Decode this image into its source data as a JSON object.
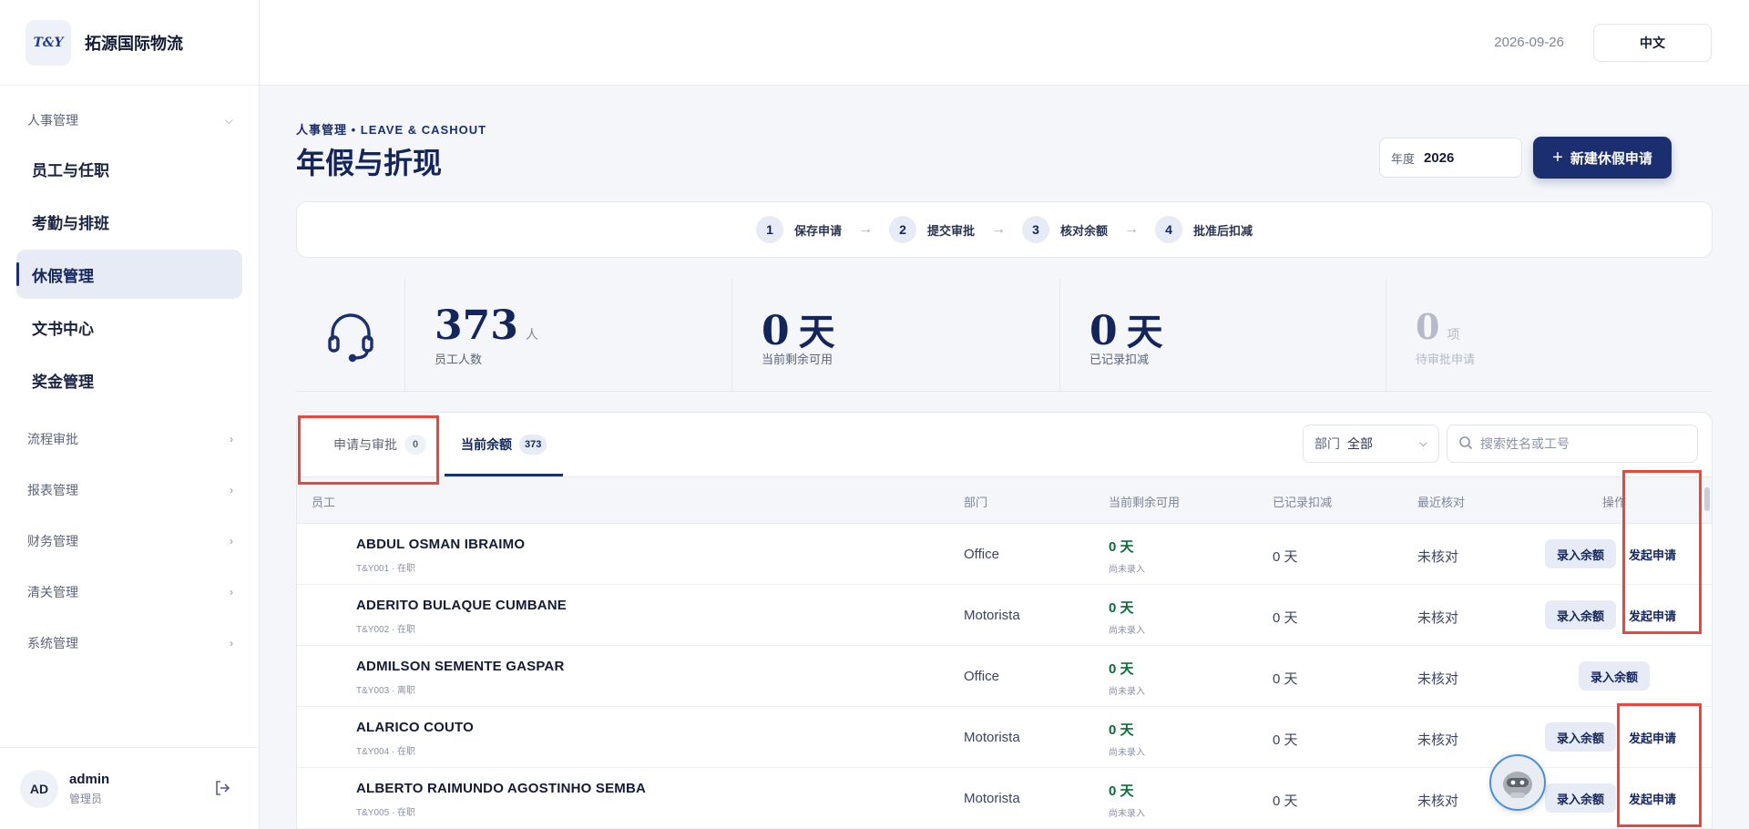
{
  "brand": {
    "logo_text": "T&Y",
    "name": "拓源国际物流"
  },
  "sidebar": {
    "group1": {
      "label": "人事管理"
    },
    "items": [
      {
        "label": "员工与任职",
        "active": false
      },
      {
        "label": "考勤与排班",
        "active": false
      },
      {
        "label": "休假管理",
        "active": true
      },
      {
        "label": "文书中心",
        "active": false
      },
      {
        "label": "奖金管理",
        "active": false
      }
    ],
    "groups": [
      {
        "label": "流程审批"
      },
      {
        "label": "报表管理"
      },
      {
        "label": "财务管理"
      },
      {
        "label": "清关管理"
      },
      {
        "label": "系统管理"
      }
    ]
  },
  "user": {
    "initials": "AD",
    "name": "admin",
    "role": "管理员"
  },
  "topbar": {
    "date": "2026-09-26",
    "language": "中文"
  },
  "page": {
    "kicker": "人事管理 • LEAVE & CASHOUT",
    "title": "年假与折现",
    "year_label": "年度",
    "year_value": "2026",
    "new_button": "新建休假申请"
  },
  "steps": [
    {
      "num": "1",
      "label": "保存申请"
    },
    {
      "num": "2",
      "label": "提交审批"
    },
    {
      "num": "3",
      "label": "核对余额"
    },
    {
      "num": "4",
      "label": "批准后扣减"
    }
  ],
  "stats": [
    {
      "value": "373",
      "unit": "人",
      "label": "员工人数"
    },
    {
      "value": "0",
      "unit": "天",
      "label": "当前剩余可用"
    },
    {
      "value": "0",
      "unit": "天",
      "label": "已记录扣减"
    },
    {
      "value": "0",
      "unit": "项",
      "label": "待审批申请"
    }
  ],
  "tabs": [
    {
      "label": "申请与审批",
      "count": "0"
    },
    {
      "label": "当前余额",
      "count": "373"
    }
  ],
  "filters": {
    "dept_label": "部门",
    "dept_value": "全部",
    "search_placeholder": "搜索姓名或工号"
  },
  "table": {
    "headers": {
      "employee": "员工",
      "dept": "部门",
      "available": "当前剩余可用",
      "used": "已记录扣减",
      "checked": "最近核对",
      "actions": "操作"
    },
    "entry_label": "录入余额",
    "apply_label": "发起申请",
    "rows": [
      {
        "name": "ABDUL OSMAN IBRAIMO",
        "sub": "T&Y001 · 在职",
        "dept": "Office",
        "available": "0 天",
        "available_sub": "尚未录入",
        "used": "0 天",
        "checked": "未核对",
        "can_apply": true
      },
      {
        "name": "ADERITO BULAQUE CUMBANE",
        "sub": "T&Y002 · 在职",
        "dept": "Motorista",
        "available": "0 天",
        "available_sub": "尚未录入",
        "used": "0 天",
        "checked": "未核对",
        "can_apply": true
      },
      {
        "name": "ADMILSON SEMENTE GASPAR",
        "sub": "T&Y003 · 离职",
        "dept": "Office",
        "available": "0 天",
        "available_sub": "尚未录入",
        "used": "0 天",
        "checked": "未核对",
        "can_apply": false
      },
      {
        "name": "ALARICO COUTO",
        "sub": "T&Y004 · 在职",
        "dept": "Motorista",
        "available": "0 天",
        "available_sub": "尚未录入",
        "used": "0 天",
        "checked": "未核对",
        "can_apply": true
      },
      {
        "name": "ALBERTO RAIMUNDO AGOSTINHO SEMBA",
        "sub": "T&Y005 · 在职",
        "dept": "Motorista",
        "available": "0 天",
        "available_sub": "尚未录入",
        "used": "0 天",
        "checked": "未核对",
        "can_apply": true
      }
    ]
  },
  "icons": {
    "stat": "headset-icon",
    "assistant": "robot-assistant-icon"
  },
  "colors": {
    "primary": "#1b2f70",
    "highlight": "#e8473e",
    "positive": "#0f6b3d"
  }
}
